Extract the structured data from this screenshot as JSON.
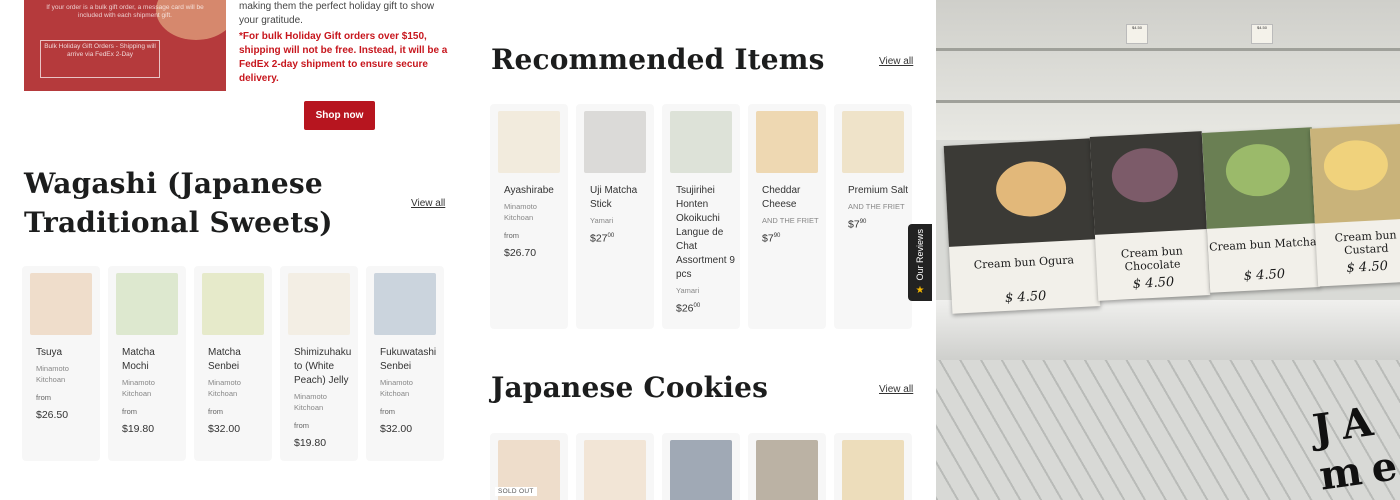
{
  "promo": {
    "image_text": "If your order is a bulk gift order, a message card will be included with each shipment gift.",
    "image_box_text": "Bulk Holiday Gift Orders - Shipping will arrive via FedEx 2-Day",
    "copy": "making them the perfect holiday gift to show your gratitude.",
    "note": "*For bulk Holiday Gift orders over $150, shipping will not be free. Instead, it will be a FedEx 2-day shipment to ensure secure delivery.",
    "button": "Shop now"
  },
  "wagashi": {
    "title": "Wagashi (Japanese Traditional Sweets)",
    "view_all": "View all",
    "items": [
      {
        "name": "Tsuya",
        "vendor": "Minamoto Kitchoan",
        "from": "from",
        "price": "$26.50",
        "thumb_color": "#e9c9a8"
      },
      {
        "name": "Matcha Mochi",
        "vendor": "Minamoto Kitchoan",
        "from": "from",
        "price": "$19.80",
        "thumb_color": "#c8dcae"
      },
      {
        "name": "Matcha Senbei",
        "vendor": "Minamoto Kitchoan",
        "from": "from",
        "price": "$32.00",
        "thumb_color": "#d9e0a6"
      },
      {
        "name": "Shimizuhaku to (White Peach) Jelly",
        "vendor": "Minamoto Kitchoan",
        "from": "from",
        "price": "$19.80",
        "thumb_color": "#f0e8d6"
      },
      {
        "name": "Fukuwatashi Senbei",
        "vendor": "Minamoto Kitchoan",
        "from": "from",
        "price": "$32.00",
        "thumb_color": "#a8b8c8"
      }
    ]
  },
  "recommended": {
    "title": "Recommended Items",
    "view_all": "View all",
    "items": [
      {
        "name": "Ayashirabe",
        "vendor": "Minamoto Kitchoan",
        "from": "from",
        "price": "$26.70",
        "thumb_color": "#efe2c9"
      },
      {
        "name": "Uji Matcha Stick",
        "vendor": "Yamari",
        "price_main": "$27",
        "price_cents": "00",
        "thumb_color": "#c4c2bf"
      },
      {
        "name": "Tsujirihei Honten Okoikuchi Langue de Chat Assortment 9 pcs",
        "vendor": "Yamari",
        "price_main": "$26",
        "price_cents": "00",
        "thumb_color": "#c9d1bf"
      },
      {
        "name": "Cheddar Cheese",
        "vendor": "AND THE FRIET",
        "price_main": "$7",
        "price_cents": "90",
        "thumb_color": "#e8c07a"
      },
      {
        "name": "Premium Salt",
        "vendor": "AND THE FRIET",
        "price_main": "$7",
        "price_cents": "90",
        "thumb_color": "#ead3a4"
      }
    ]
  },
  "cookies": {
    "title": "Japanese Cookies",
    "view_all": "View all",
    "sold_out": "SOLD OUT",
    "thumb_colors": [
      "#e8c9a8",
      "#efd7bb",
      "#5a6a80",
      "#8a7a60",
      "#e5c98a"
    ]
  },
  "photo": {
    "cards": [
      {
        "label": "Cream bun Ogura",
        "price": "$ 4.50"
      },
      {
        "label": "Cream bun Chocolate",
        "price": "$ 4.50"
      },
      {
        "label": "Cream bun Matcha",
        "price": "$ 4.50"
      },
      {
        "label": "Cream bun Custard",
        "price": "$ 4.50"
      }
    ],
    "shelf_sign_a": "$4.50",
    "shelf_sign_b": "$4.50",
    "logo_text": "JA me"
  },
  "reviews_tab": {
    "label": "Our Reviews",
    "icon": "star-icon"
  }
}
